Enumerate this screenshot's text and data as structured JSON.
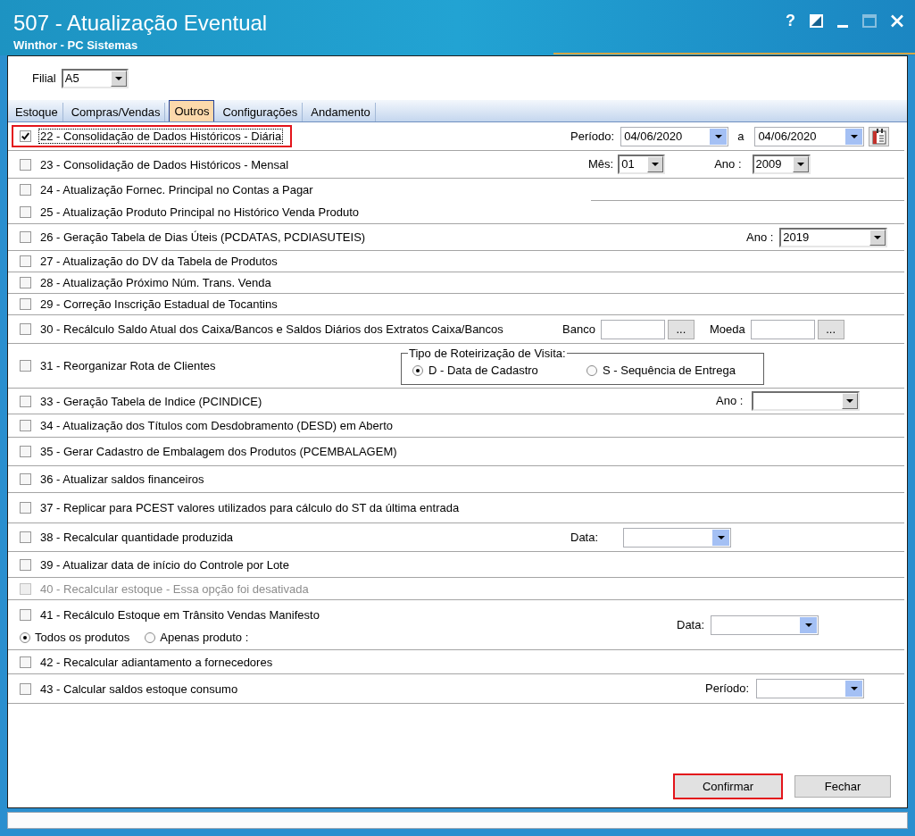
{
  "window": {
    "title": "507 - Atualização Eventual",
    "subtitle": "Winthor - PC Sistemas"
  },
  "title_buttons": [
    {
      "kind": "help",
      "label": "?",
      "disabled": false
    },
    {
      "kind": "contrast",
      "disabled": false
    },
    {
      "kind": "minimize",
      "disabled": false
    },
    {
      "kind": "maximize",
      "disabled": true
    },
    {
      "kind": "close",
      "disabled": false
    }
  ],
  "filial": {
    "label": "Filial",
    "value": "A5"
  },
  "tabs": [
    {
      "label": "Estoque",
      "selected": false
    },
    {
      "label": "Compras/Vendas",
      "selected": false
    },
    {
      "label": "Outros",
      "selected": true
    },
    {
      "label": "Configurações",
      "selected": false
    },
    {
      "label": "Andamento",
      "selected": false
    }
  ],
  "options": [
    {
      "label": "22 - Consolidação de Dados Históricos - Diária",
      "checked": true,
      "disabled": false,
      "focused": true,
      "highlighted": true,
      "controls": [
        {
          "kind": "label",
          "text": "Período:"
        },
        {
          "kind": "date",
          "value": "04/06/2020"
        },
        {
          "kind": "label",
          "text": "a"
        },
        {
          "kind": "date",
          "value": "04/06/2020"
        },
        {
          "kind": "calendar"
        }
      ]
    },
    {
      "label": "23 - Consolidação de Dados Históricos - Mensal",
      "checked": false,
      "disabled": false,
      "focused": false,
      "highlighted": false,
      "controls": [
        {
          "kind": "label",
          "text": "Mês:"
        },
        {
          "kind": "combo",
          "value": "01"
        },
        {
          "kind": "label",
          "text": "Ano :"
        },
        {
          "kind": "combo",
          "value": "2009"
        }
      ]
    },
    {
      "label": "24 - Atualização Fornec. Principal no Contas a Pagar",
      "checked": false,
      "disabled": false,
      "focused": false,
      "highlighted": false
    },
    {
      "label": "25 - Atualização Produto Principal no Histórico Venda Produto",
      "checked": false,
      "disabled": false,
      "focused": false,
      "highlighted": false
    },
    {
      "label": "26 - Geração Tabela de Dias Úteis (PCDATAS, PCDIASUTEIS)",
      "checked": false,
      "disabled": false,
      "focused": false,
      "highlighted": false,
      "controls": [
        {
          "kind": "label",
          "text": "Ano :"
        },
        {
          "kind": "combo",
          "value": "2019"
        }
      ]
    },
    {
      "label": "27 - Atualização do DV da Tabela de Produtos",
      "checked": false,
      "disabled": false,
      "focused": false,
      "highlighted": false
    },
    {
      "label": "28 - Atualização Próximo Núm. Trans. Venda",
      "checked": false,
      "disabled": false,
      "focused": false,
      "highlighted": false
    },
    {
      "label": "29 - Correção Inscrição Estadual de Tocantins",
      "checked": false,
      "disabled": false,
      "focused": false,
      "highlighted": false
    },
    {
      "label": "30 - Recálculo Saldo Atual dos Caixa/Bancos e Saldos Diários dos Extratos Caixa/Bancos",
      "checked": false,
      "disabled": false,
      "focused": false,
      "highlighted": false,
      "controls": [
        {
          "kind": "label",
          "text": "Banco"
        },
        {
          "kind": "lookup",
          "button": "..."
        },
        {
          "kind": "label",
          "text": "Moeda"
        },
        {
          "kind": "lookup",
          "button": "..."
        }
      ]
    },
    {
      "label": "31 - Reorganizar Rota de Clientes",
      "checked": false,
      "disabled": false,
      "focused": false,
      "highlighted": false,
      "controls": [
        {
          "kind": "radio_group",
          "title": "Tipo de Roteirização de Visita:",
          "options": [
            {
              "label": "D - Data de Cadastro",
              "selected": true
            },
            {
              "label": "S - Sequência de Entrega",
              "selected": false
            }
          ]
        }
      ]
    },
    {
      "label": "33 - Geração Tabela de Indice (PCINDICE)",
      "checked": false,
      "disabled": false,
      "focused": false,
      "highlighted": false,
      "controls": [
        {
          "kind": "label",
          "text": "Ano :"
        },
        {
          "kind": "combo"
        }
      ]
    },
    {
      "label": "34 - Atualização dos Títulos com Desdobramento (DESD) em Aberto",
      "checked": false,
      "disabled": false,
      "focused": false,
      "highlighted": false
    },
    {
      "label": "35 - Gerar Cadastro de Embalagem dos Produtos (PCEMBALAGEM)",
      "checked": false,
      "disabled": false,
      "focused": false,
      "highlighted": false
    },
    {
      "label": "36 - Atualizar saldos financeiros",
      "checked": false,
      "disabled": false,
      "focused": false,
      "highlighted": false
    },
    {
      "label": "37 - Replicar para PCEST valores utilizados para cálculo do ST da última entrada",
      "checked": false,
      "disabled": false,
      "focused": false,
      "highlighted": false
    },
    {
      "label": "38 - Recalcular quantidade produzida",
      "checked": false,
      "disabled": false,
      "focused": false,
      "highlighted": false,
      "controls": [
        {
          "kind": "label",
          "text": "Data:"
        },
        {
          "kind": "date"
        }
      ]
    },
    {
      "label": "39 - Atualizar data de início do Controle por Lote",
      "checked": false,
      "disabled": false,
      "focused": false,
      "highlighted": false
    },
    {
      "label": "40 - Recalcular estoque - Essa opção foi desativada",
      "checked": false,
      "disabled": true,
      "focused": false,
      "highlighted": false
    },
    {
      "label": "41 - Recálculo Estoque em Trânsito Vendas Manifesto",
      "checked": false,
      "disabled": false,
      "focused": false,
      "highlighted": false,
      "choices": [
        {
          "label": "Todos os produtos",
          "selected": true
        },
        {
          "label": "Apenas produto :",
          "selected": false
        }
      ],
      "controls": [
        {
          "kind": "label",
          "text": "Data:"
        },
        {
          "kind": "date"
        }
      ]
    },
    {
      "label": "42 - Recalcular adiantamento a fornecedores",
      "checked": false,
      "disabled": false,
      "focused": false,
      "highlighted": false
    },
    {
      "label": "43 - Calcular saldos estoque consumo",
      "checked": false,
      "disabled": false,
      "focused": false,
      "highlighted": false,
      "controls": [
        {
          "kind": "label",
          "text": "Período:"
        },
        {
          "kind": "date"
        }
      ]
    }
  ],
  "buttons": [
    {
      "label": "Confirmar",
      "highlighted": true
    },
    {
      "label": "Fechar",
      "highlighted": false
    }
  ]
}
